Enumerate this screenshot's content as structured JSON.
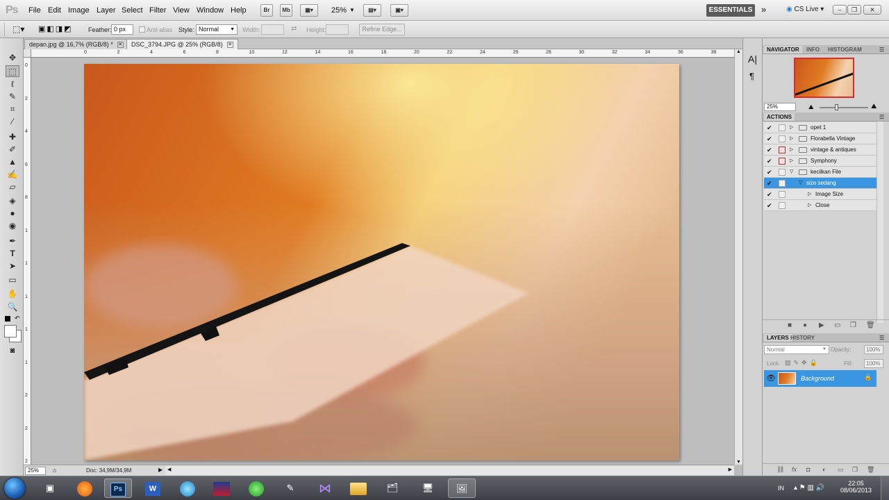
{
  "app": {
    "logo": "Ps"
  },
  "menu": [
    "File",
    "Edit",
    "Image",
    "Layer",
    "Select",
    "Filter",
    "View",
    "Window",
    "Help"
  ],
  "appbar": {
    "br": "Br",
    "mb": "Mb",
    "zoom": "25%",
    "workspace": "ESSENTIALS",
    "cslive": "CS Live"
  },
  "options": {
    "feather_label": "Feather:",
    "feather_value": "0 px",
    "antialias_label": "Anti-alias",
    "style_label": "Style:",
    "style_value": "Normal",
    "width_label": "Width:",
    "height_label": "Height:",
    "refine_label": "Refine Edge..."
  },
  "documents": [
    {
      "title": "depan.jpg @ 16,7% (RGB/8) *"
    },
    {
      "title": "DSC_3794.JPG @ 25% (RGB/8)"
    }
  ],
  "ruler_top": [
    "0",
    "2",
    "4",
    "6",
    "8",
    "10",
    "12",
    "14",
    "16",
    "18",
    "20",
    "22",
    "24",
    "26",
    "28",
    "30",
    "32",
    "34",
    "36",
    "38"
  ],
  "ruler_left": [
    "0",
    "2",
    "4",
    "6",
    "8",
    "1",
    "1",
    "1",
    "1",
    "1",
    "2",
    "2",
    "2"
  ],
  "status": {
    "zoom": "25%",
    "doc": "Doc: 34,9M/34,9M"
  },
  "navigator": {
    "tabs": [
      "NAVIGATOR",
      "INFO",
      "HISTOGRAM"
    ],
    "zoom": "25%"
  },
  "actions": {
    "tab": "ACTIONS",
    "items": [
      {
        "label": "opet 1",
        "dialog": false,
        "level": 0,
        "expanded": false
      },
      {
        "label": "Florabella Vintage",
        "dialog": false,
        "level": 0,
        "expanded": false
      },
      {
        "label": "vintage & antiques",
        "dialog": true,
        "level": 0,
        "expanded": false
      },
      {
        "label": "Symphony",
        "dialog": true,
        "level": 0,
        "expanded": false
      },
      {
        "label": "kecilkan File",
        "dialog": false,
        "level": 0,
        "expanded": true
      },
      {
        "label": "size sedang",
        "dialog": false,
        "level": 1,
        "expanded": true,
        "selected": true
      },
      {
        "label": "Image Size",
        "dialog": false,
        "level": 2,
        "expanded": false
      },
      {
        "label": "Close",
        "dialog": false,
        "level": 2,
        "expanded": false
      }
    ]
  },
  "layers": {
    "tabs": [
      "LAYERS",
      "HISTORY"
    ],
    "blend": "Normal",
    "opacity_label": "Opacity:",
    "opacity": "100%",
    "lock_label": "Lock:",
    "fill_label": "Fill:",
    "fill": "100%",
    "items": [
      {
        "name": "Background"
      }
    ]
  },
  "taskbar": {
    "lang": "IN",
    "time": "22:05",
    "date": "08/06/2013",
    "ps_label": "Ps",
    "word_label": "W"
  }
}
